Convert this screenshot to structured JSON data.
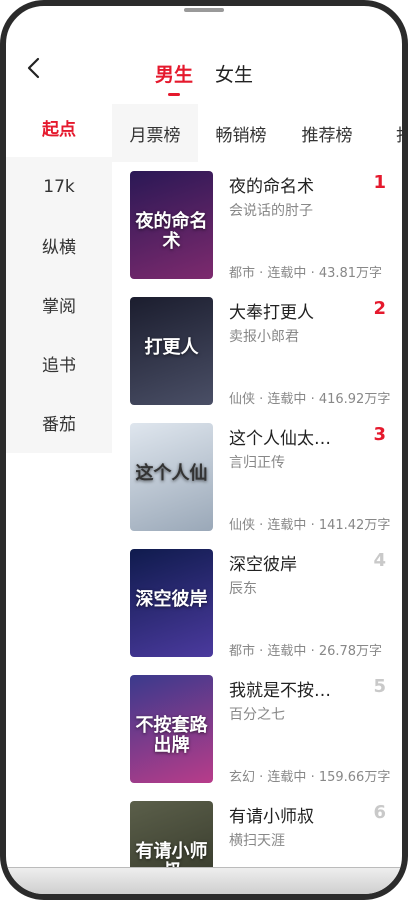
{
  "header": {
    "tabs": [
      {
        "label": "男生",
        "active": true
      },
      {
        "label": "女生",
        "active": false
      }
    ]
  },
  "sidebar": {
    "items": [
      {
        "label": "起点",
        "active": true
      },
      {
        "label": "17k",
        "active": false
      },
      {
        "label": "纵横",
        "active": false
      },
      {
        "label": "掌阅",
        "active": false
      },
      {
        "label": "追书",
        "active": false
      },
      {
        "label": "番茄",
        "active": false
      }
    ]
  },
  "rank_tabs": [
    {
      "label": "月票榜",
      "active": true
    },
    {
      "label": "畅销榜",
      "active": false
    },
    {
      "label": "推荐榜",
      "active": false
    },
    {
      "label": "打赏",
      "active": false
    }
  ],
  "books": [
    {
      "rank": "1",
      "title": "夜的命名术",
      "author": "会说话的肘子",
      "category": "都市",
      "status": "连载中",
      "words": "43.81万字",
      "cover_text": "夜的命名术",
      "cover_colors": [
        "#2a1855",
        "#7d2a6e"
      ]
    },
    {
      "rank": "2",
      "title": "大奉打更人",
      "author": "卖报小郎君",
      "category": "仙侠",
      "status": "连载中",
      "words": "416.92万字",
      "cover_text": "打更人",
      "cover_colors": [
        "#1b1d2e",
        "#4a4f66"
      ]
    },
    {
      "rank": "3",
      "title": "这个人仙太…",
      "author": "言归正传",
      "category": "仙侠",
      "status": "连载中",
      "words": "141.42万字",
      "cover_text": "这个人仙",
      "cover_colors": [
        "#dfe6ee",
        "#9aa8b8"
      ]
    },
    {
      "rank": "4",
      "title": "深空彼岸",
      "author": "辰东",
      "category": "都市",
      "status": "连载中",
      "words": "26.78万字",
      "cover_text": "深空彼岸",
      "cover_colors": [
        "#0f1b4d",
        "#4b3a9e"
      ]
    },
    {
      "rank": "5",
      "title": "我就是不按…",
      "author": "百分之七",
      "category": "玄幻",
      "status": "连载中",
      "words": "159.66万字",
      "cover_text": "不按套路出牌",
      "cover_colors": [
        "#3a3a8c",
        "#b83c8a"
      ]
    },
    {
      "rank": "6",
      "title": "有请小师叔",
      "author": "横扫天涯",
      "category": "",
      "status": "",
      "words": "",
      "cover_text": "有请小师叔",
      "cover_colors": [
        "#5b5f4a",
        "#2e3124"
      ]
    }
  ]
}
